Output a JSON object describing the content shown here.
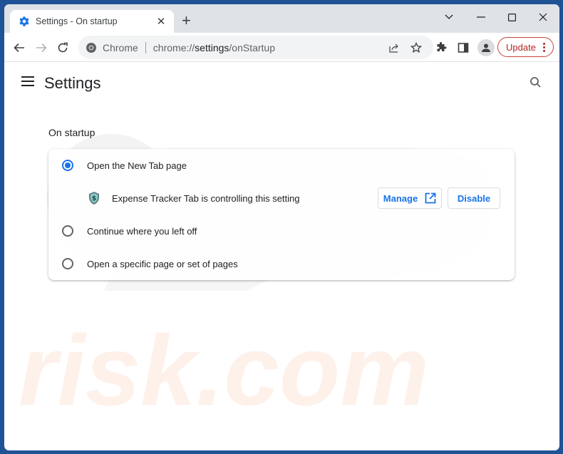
{
  "browser": {
    "tab": {
      "title": "Settings - On startup",
      "icon": "gear-icon",
      "close_icon": "close-icon"
    },
    "new_tab_icon": "plus-icon",
    "window_controls": [
      "chevron-down-icon",
      "minimize-icon",
      "maximize-icon",
      "close-icon"
    ],
    "omnibox": {
      "site_label": "Chrome",
      "url_prefix": "chrome://",
      "url_host": "settings",
      "url_path": "/onStartup"
    },
    "update_label": "Update",
    "accent_color": "#1a73e8",
    "update_color": "#b3261e"
  },
  "settings": {
    "title": "Settings",
    "section_title": "On startup",
    "options": [
      {
        "label": "Open the New Tab page",
        "selected": true
      },
      {
        "label": "Continue where you left off",
        "selected": false
      },
      {
        "label": "Open a specific page or set of pages",
        "selected": false
      }
    ],
    "extension_notice": {
      "text": "Expense Tracker Tab is controlling this setting",
      "manage_label": "Manage",
      "disable_label": "Disable"
    }
  },
  "watermark": {
    "text": "risk.com"
  }
}
